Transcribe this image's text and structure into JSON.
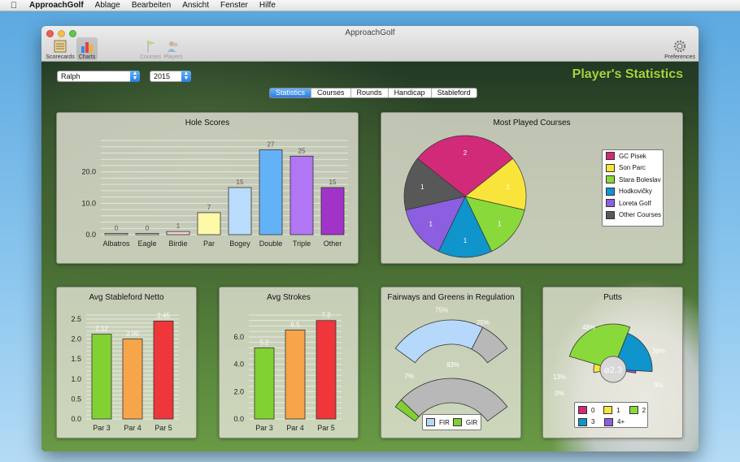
{
  "menubar": {
    "app_name": "ApproachGolf",
    "items": [
      "Ablage",
      "Bearbeiten",
      "Ansicht",
      "Fenster",
      "Hilfe"
    ]
  },
  "window": {
    "title": "ApproachGolf",
    "toolbar": {
      "scorecards": "Scorecards",
      "charts": "Charts",
      "courses": "Courses",
      "players": "Players",
      "preferences": "Preferences"
    }
  },
  "filters": {
    "player": "Ralph",
    "year": "2015"
  },
  "page_title": "Player's Statistics",
  "tabs": [
    "Statistics",
    "Courses",
    "Rounds",
    "Handicap",
    "Stableford"
  ],
  "active_tab": "Statistics",
  "chart_data": [
    {
      "type": "bar",
      "title": "Hole Scores",
      "categories": [
        "Albatros",
        "Eagle",
        "Birdie",
        "Par",
        "Bogey",
        "Double",
        "Triple",
        "Other"
      ],
      "values": [
        0,
        0,
        1,
        7,
        15,
        27,
        25,
        15
      ],
      "colors": [
        "#f0f0f0",
        "#f0f0f0",
        "#f4d0d0",
        "#fdf7a8",
        "#b9dbfc",
        "#63b2f7",
        "#b176f4",
        "#a233c8"
      ],
      "yticks": [
        "0.0",
        "10.0",
        "20.0"
      ],
      "ylim": [
        0,
        30
      ]
    },
    {
      "type": "pie",
      "title": "Most Played Courses",
      "labels": [
        "GC Pisek",
        "Son Parc",
        "Stara Boleslav",
        "Hodkovičky",
        "Loreta Golf",
        "Other Courses"
      ],
      "values": [
        2,
        1,
        1,
        1,
        1,
        1
      ],
      "colors": [
        "#d12a78",
        "#f9e43c",
        "#8ad93a",
        "#0f94cc",
        "#8c5ee0",
        "#585858"
      ]
    },
    {
      "type": "bar",
      "title": "Avg Stableford Netto",
      "categories": [
        "Par 3",
        "Par 4",
        "Par 5"
      ],
      "values": [
        2.12,
        2.0,
        2.45
      ],
      "value_labels": [
        "2.12",
        "2.00",
        "2.45"
      ],
      "colors": [
        "#82d132",
        "#f7a54a",
        "#ee363b"
      ],
      "yticks": [
        "0.0",
        "0.5",
        "1.0",
        "1.5",
        "2.0",
        "2.5"
      ],
      "ylim": [
        0,
        2.6
      ]
    },
    {
      "type": "bar",
      "title": "Avg Strokes",
      "categories": [
        "Par 3",
        "Par 4",
        "Par 5"
      ],
      "values": [
        5.2,
        6.5,
        7.2
      ],
      "value_labels": [
        "5.2",
        "6.5",
        "7.2"
      ],
      "colors": [
        "#82d132",
        "#f7a54a",
        "#ee363b"
      ],
      "yticks": [
        "0.0",
        "2.0",
        "4.0",
        "6.0"
      ],
      "ylim": [
        0,
        7.6
      ]
    },
    {
      "type": "pie",
      "title": "Fairways and Greens in Regulation",
      "series": [
        {
          "name": "FIR",
          "values": [
            75,
            25
          ],
          "value_labels": [
            "75%",
            "25%"
          ],
          "color": "#b6d9fb"
        },
        {
          "name": "GIR",
          "values": [
            7,
            93
          ],
          "value_labels": [
            "7%",
            "93%"
          ],
          "color": "#80cf34"
        }
      ],
      "rest_color": "#b8b8b8",
      "legend": [
        "FIR",
        "GIR"
      ]
    },
    {
      "type": "pie",
      "title": "Putts",
      "labels": [
        "0",
        "1",
        "2",
        "3",
        "4+"
      ],
      "values": [
        0,
        13,
        48,
        36,
        3
      ],
      "value_labels": [
        "0%",
        "13%",
        "48%",
        "36%",
        "3%"
      ],
      "colors": [
        "#d12a78",
        "#f9e43c",
        "#8ad93a",
        "#0f94cc",
        "#8c5ee0"
      ],
      "center_label": "⌀2.3"
    }
  ]
}
